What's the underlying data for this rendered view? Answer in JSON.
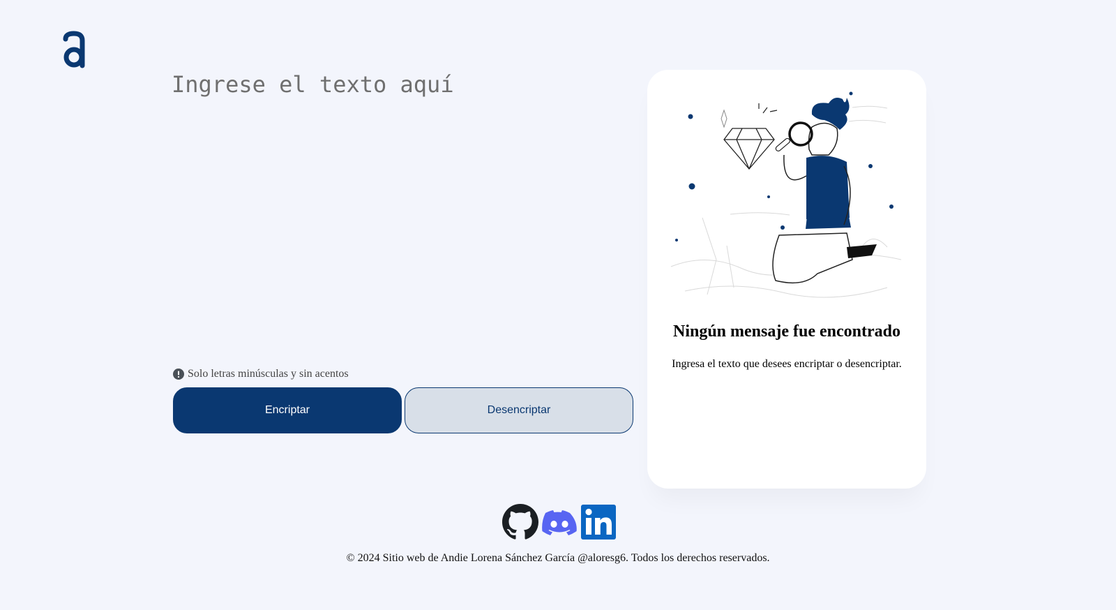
{
  "input": {
    "placeholder": "Ingrese el texto aquí",
    "value": ""
  },
  "hint": {
    "icon": "exclamation-circle-icon",
    "text": "Solo letras minúsculas y sin acentos"
  },
  "buttons": {
    "encrypt_label": "Encriptar",
    "decrypt_label": "Desencriptar"
  },
  "result": {
    "illustration": "person-with-magnifying-glass-illustration",
    "title": "Ningún mensaje fue encontrado",
    "text": "Ingresa el texto que desees encriptar o desencriptar."
  },
  "social": [
    {
      "icon": "github-icon"
    },
    {
      "icon": "discord-icon"
    },
    {
      "icon": "linkedin-icon"
    }
  ],
  "footer": {
    "text": "© 2024 Sitio web de Andie Lorena Sánchez García @aloresg6. Todos los derechos reservados."
  },
  "colors": {
    "background": "#f3f5fc",
    "primary": "#0a3871",
    "secondary_button": "#d8dfe8",
    "discord": "#5865f2",
    "linkedin": "#0a66c2"
  }
}
